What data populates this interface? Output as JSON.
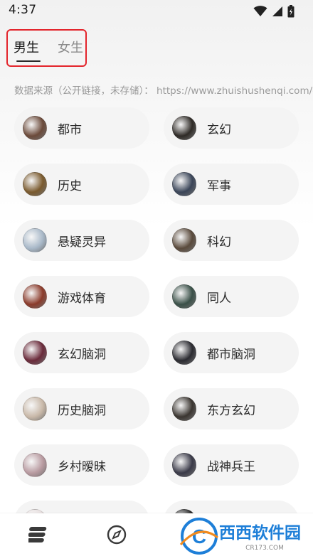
{
  "status_bar": {
    "time": "4:37",
    "icons": [
      "wifi-icon",
      "signal-icon",
      "battery-icon"
    ]
  },
  "tabs": [
    {
      "label": "男生",
      "active": true
    },
    {
      "label": "女生",
      "active": false
    }
  ],
  "source_note": "数据来源（公开链接，未存储）： https://www.zhuishushenqi.com/c...",
  "categories": [
    {
      "label": "都市",
      "cover_color": "#6b4a3a"
    },
    {
      "label": "玄幻",
      "cover_color": "#2e2a26"
    },
    {
      "label": "历史",
      "cover_color": "#7a5a2e"
    },
    {
      "label": "军事",
      "cover_color": "#3a4558"
    },
    {
      "label": "悬疑灵异",
      "cover_color": "#a8b8c8"
    },
    {
      "label": "科幻",
      "cover_color": "#5a4a3c"
    },
    {
      "label": "游戏体育",
      "cover_color": "#8a3a2a"
    },
    {
      "label": "同人",
      "cover_color": "#3a5048"
    },
    {
      "label": "玄幻脑洞",
      "cover_color": "#6a2a3a"
    },
    {
      "label": "都市脑洞",
      "cover_color": "#2a2a30"
    },
    {
      "label": "历史脑洞",
      "cover_color": "#c8b8a8"
    },
    {
      "label": "东方玄幻",
      "cover_color": "#3a3530"
    },
    {
      "label": "乡村暧昧",
      "cover_color": "#b89aa0"
    },
    {
      "label": "战神兵王",
      "cover_color": "#3a3a48"
    },
    {
      "label": "",
      "cover_color": "#e8e0e0"
    },
    {
      "label": "",
      "cover_color": "#2a2a2a"
    }
  ],
  "bottom_nav": {
    "items": [
      "bookshelf-icon",
      "compass-icon"
    ],
    "icon_color": "#3a3a3a"
  },
  "watermark": {
    "brand": "西西软件园",
    "site": "CR173.COM",
    "accent": "#1e7fd8"
  },
  "colors": {
    "highlight_border": "#e3242b",
    "item_bg": "#f4f4f4"
  }
}
